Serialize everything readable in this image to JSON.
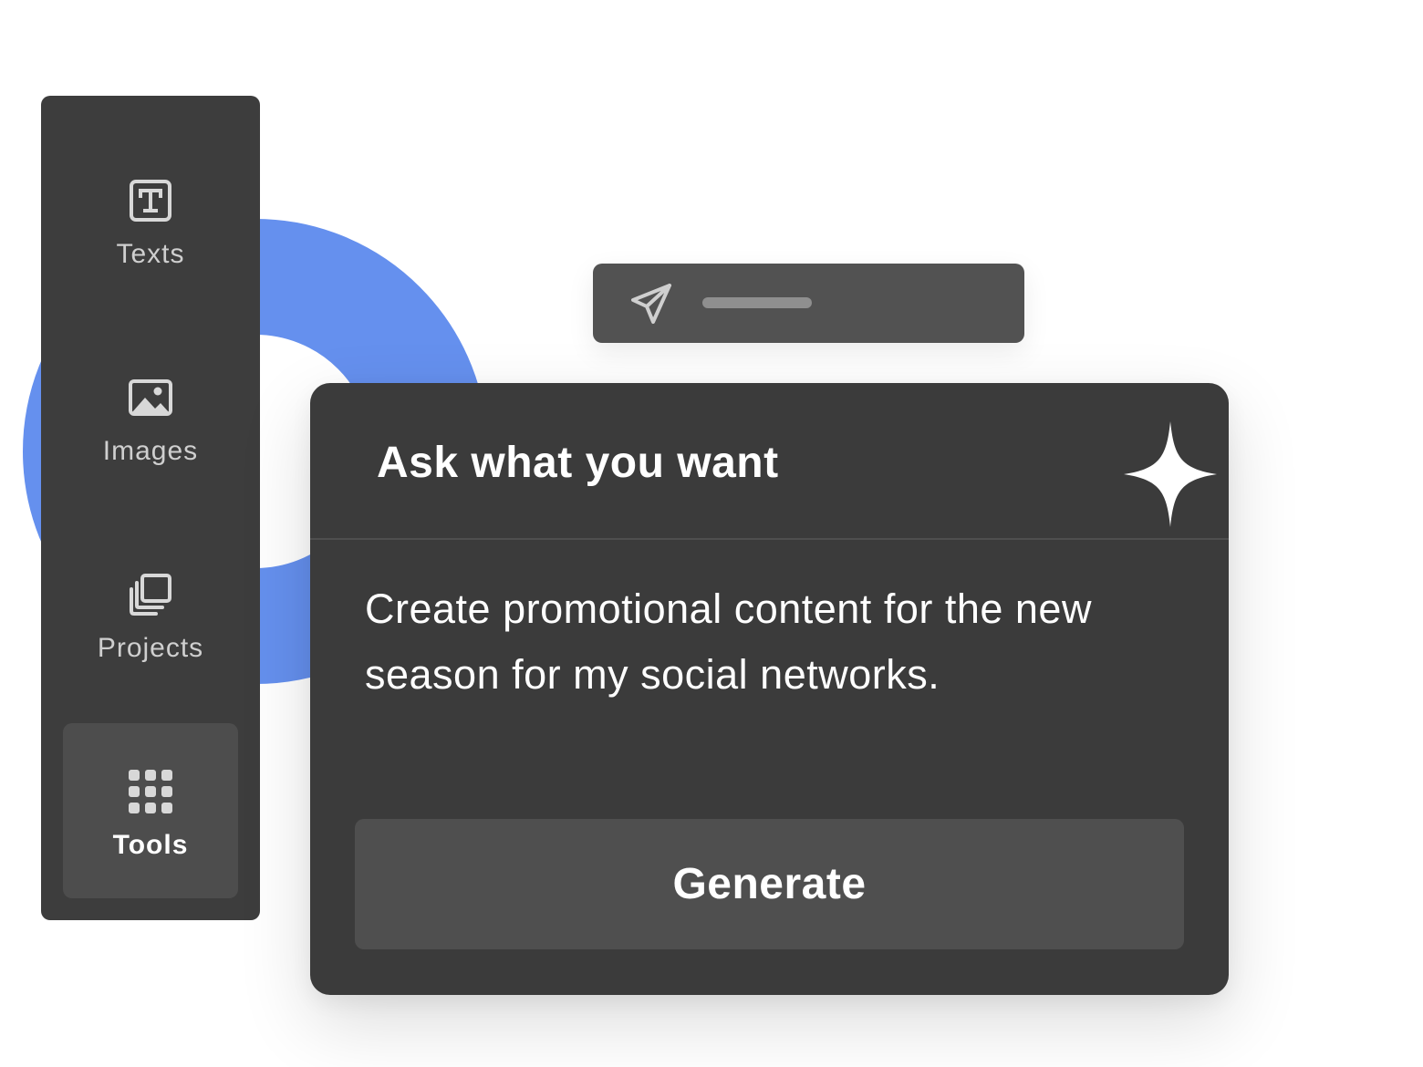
{
  "colors": {
    "ring_accent": "#6590ee",
    "panel_dark": "#3d3d3d",
    "active_item": "#4d4d4d",
    "button": "#4f4f4f"
  },
  "sidebar": {
    "items": [
      {
        "label": "Texts",
        "icon": "text-icon",
        "active": false
      },
      {
        "label": "Images",
        "icon": "image-icon",
        "active": false
      },
      {
        "label": "Projects",
        "icon": "projects-icon",
        "active": false
      },
      {
        "label": "Tools",
        "icon": "grid-icon",
        "active": true
      }
    ]
  },
  "send_bar": {
    "icon": "paper-plane-icon"
  },
  "card": {
    "title": "Ask what you want",
    "icon": "sparkle-icon",
    "prompt": "Create promotional content for the new season for my social networks.",
    "generate_label": "Generate"
  }
}
